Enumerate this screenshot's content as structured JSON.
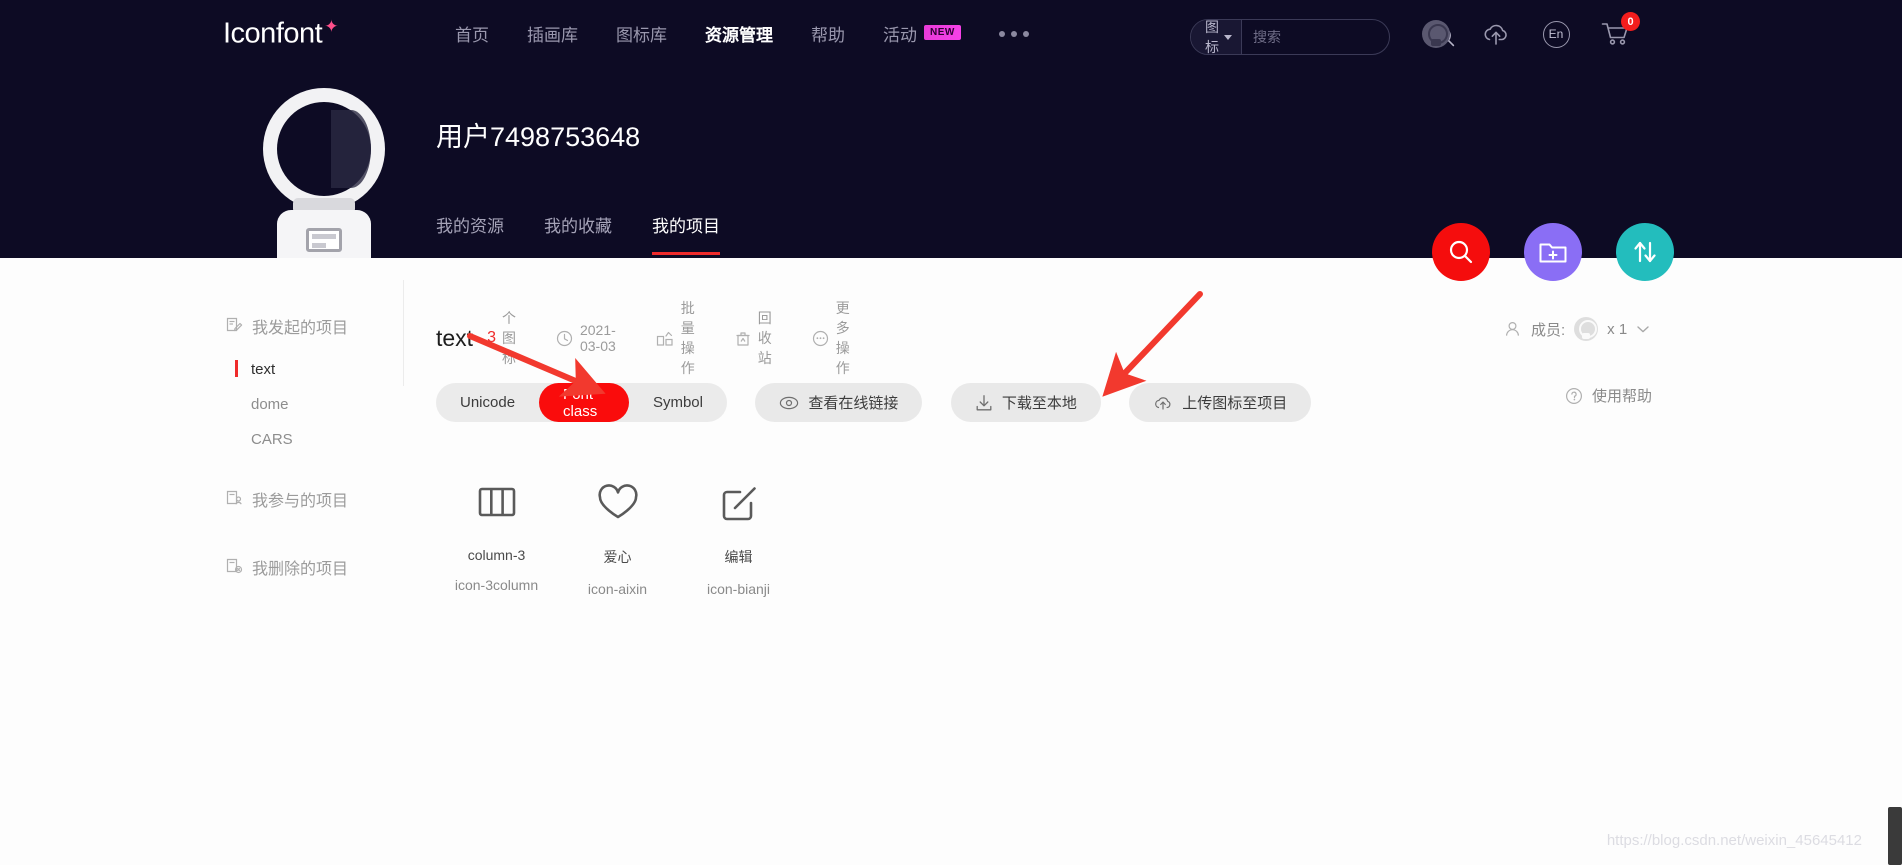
{
  "header": {
    "brand": "Iconfont",
    "brand_star": "✦",
    "nav": [
      {
        "label": "首页",
        "active": false
      },
      {
        "label": "插画库",
        "active": false
      },
      {
        "label": "图标库",
        "active": false
      },
      {
        "label": "资源管理",
        "active": true
      },
      {
        "label": "帮助",
        "active": false
      },
      {
        "label": "活动",
        "active": false,
        "badge": "NEW"
      }
    ],
    "more_icon": "ellipsis-icon",
    "search": {
      "category": "图标",
      "placeholder": "搜索",
      "value": "",
      "icon": "search-icon"
    },
    "icons": [
      {
        "name": "user-avatar-icon"
      },
      {
        "name": "cloud-upload-icon"
      },
      {
        "name": "language-icon",
        "label": "En"
      },
      {
        "name": "cart-icon",
        "badge": "0"
      }
    ],
    "cart_badge": "0",
    "lang_label": "En"
  },
  "profile": {
    "avatar_icon": "astronaut-avatar",
    "username": "用户7498753648",
    "tabs": [
      {
        "label": "我的资源",
        "active": false
      },
      {
        "label": "我的收藏",
        "active": false
      },
      {
        "label": "我的项目",
        "active": true
      }
    ]
  },
  "fabs": [
    {
      "name": "search-fab",
      "icon": "search-icon",
      "color": "#f50d0d"
    },
    {
      "name": "new-project-fab",
      "icon": "folder-plus-icon",
      "color": "#8a6ef5"
    },
    {
      "name": "sort-fab",
      "icon": "sort-updown-icon",
      "color": "#23bdbd"
    }
  ],
  "sidebar": {
    "groups": [
      {
        "label": "我发起的项目",
        "icon": "project-edit-icon",
        "items": [
          {
            "label": "text",
            "active": true
          },
          {
            "label": "dome",
            "active": false
          },
          {
            "label": "CARS",
            "active": false
          }
        ]
      },
      {
        "label": "我参与的项目",
        "icon": "project-member-icon",
        "items": []
      },
      {
        "label": "我删除的项目",
        "icon": "project-deleted-icon",
        "items": []
      }
    ]
  },
  "project": {
    "name": "text",
    "count": "3",
    "count_label": "个图标",
    "date": "2021-03-03",
    "date_icon": "clock-icon",
    "actions": [
      {
        "label": "批量操作",
        "icon": "batch-icon"
      },
      {
        "label": "回收站",
        "icon": "trash-icon"
      },
      {
        "label": "更多操作",
        "icon": "more-circle-icon"
      }
    ],
    "members_label": "成员:",
    "members_count": "x 1",
    "help_label": "使用帮助",
    "help_icon": "question-circle-icon"
  },
  "toolbar": {
    "segments": [
      {
        "label": "Unicode",
        "active": false
      },
      {
        "label": "Font class",
        "active": true
      },
      {
        "label": "Symbol",
        "active": false
      }
    ],
    "buttons": [
      {
        "label": "查看在线链接",
        "icon": "eye-icon"
      },
      {
        "label": "下载至本地",
        "icon": "download-icon"
      },
      {
        "label": "上传图标至项目",
        "icon": "cloud-up-icon"
      }
    ]
  },
  "icons_grid": [
    {
      "glyph": "column-3-icon",
      "name": "column-3",
      "class_name": "icon-3column"
    },
    {
      "glyph": "heart-icon",
      "name": "爱心",
      "class_name": "icon-aixin"
    },
    {
      "glyph": "edit-square-icon",
      "name": "编辑",
      "class_name": "icon-bianji"
    }
  ],
  "annotations": {
    "arrow_color": "#f2392e",
    "arrow1_target": "Font class",
    "arrow2_target": "下载至本地"
  },
  "watermark": "https://blog.csdn.net/weixin_45645412"
}
